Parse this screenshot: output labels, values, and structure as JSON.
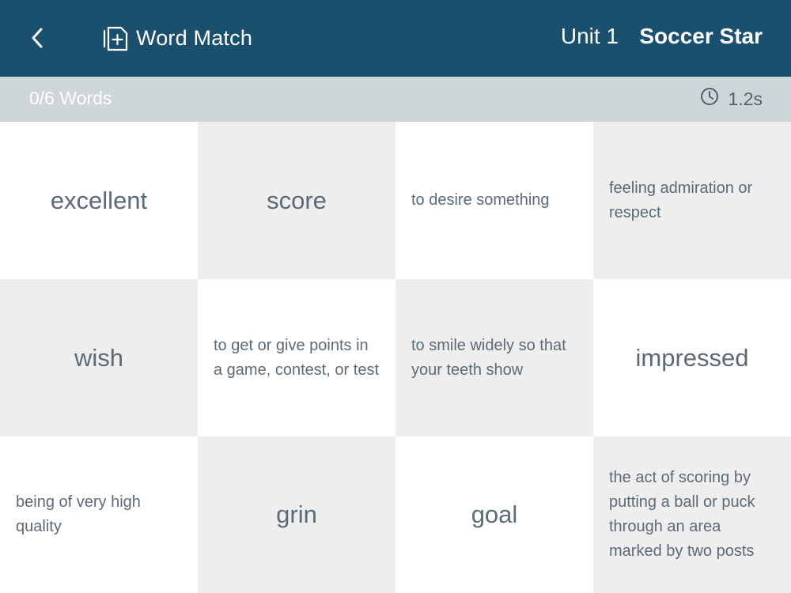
{
  "header": {
    "back_icon": "chevron-left-icon",
    "app_icon": "add-card-icon",
    "app_title": "Word Match",
    "unit": "Unit 1",
    "book_title": "Soccer Star",
    "background_color": "#1b4f6e"
  },
  "status_bar": {
    "progress": "0/6 Words",
    "timer_icon": "clock-icon",
    "timer": "1.2s"
  },
  "cards": [
    {
      "text": "excellent",
      "kind": "word"
    },
    {
      "text": "score",
      "kind": "word"
    },
    {
      "text": "to desire something",
      "kind": "definition"
    },
    {
      "text": "feeling admiration or respect",
      "kind": "definition"
    },
    {
      "text": "wish",
      "kind": "word"
    },
    {
      "text": "to get or give points in a game, contest, or test",
      "kind": "definition"
    },
    {
      "text": "to smile widely so that your teeth show",
      "kind": "definition"
    },
    {
      "text": "impressed",
      "kind": "word"
    },
    {
      "text": "being of very high quality",
      "kind": "definition"
    },
    {
      "text": "grin",
      "kind": "word"
    },
    {
      "text": "goal",
      "kind": "word"
    },
    {
      "text": "the act of scoring by putting a ball or puck through an area marked by two posts",
      "kind": "definition"
    }
  ]
}
